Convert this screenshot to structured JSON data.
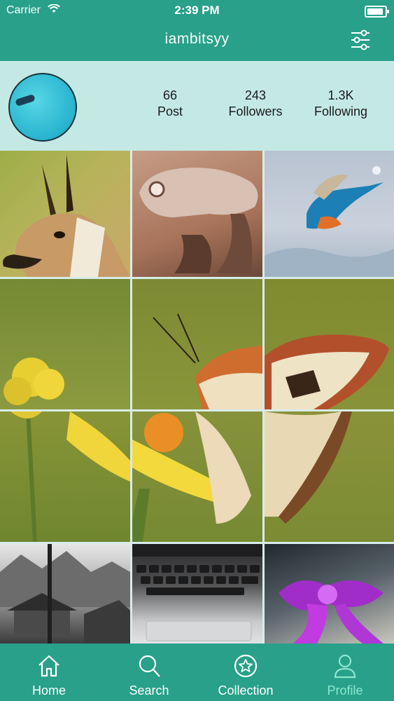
{
  "status_bar": {
    "carrier": "Carrier",
    "time": "2:39 PM"
  },
  "header": {
    "title": "iambitsyy",
    "filter_icon": "sliders-icon"
  },
  "profile": {
    "stats": [
      {
        "value": "66",
        "label": "Post"
      },
      {
        "value": "243",
        "label": "Followers"
      },
      {
        "value": "1.3K",
        "label": "Following"
      }
    ]
  },
  "grid": {
    "photos": [
      "antelope",
      "chameleon",
      "kingfisher",
      "butterfly-1",
      "butterfly-2",
      "butterfly-3",
      "butterfly-4",
      "butterfly-5",
      "butterfly-6",
      "mountain-village",
      "laptop-keyboard",
      "purple-bow"
    ]
  },
  "tabs": [
    {
      "label": "Home",
      "icon": "home-icon"
    },
    {
      "label": "Search",
      "icon": "search-icon"
    },
    {
      "label": "Collection",
      "icon": "star-icon"
    },
    {
      "label": "Profile",
      "icon": "user-icon"
    }
  ],
  "colors": {
    "primary": "#28a08a",
    "profile_bg": "#c4e9e5",
    "active_tab": "#8ce8cf"
  }
}
